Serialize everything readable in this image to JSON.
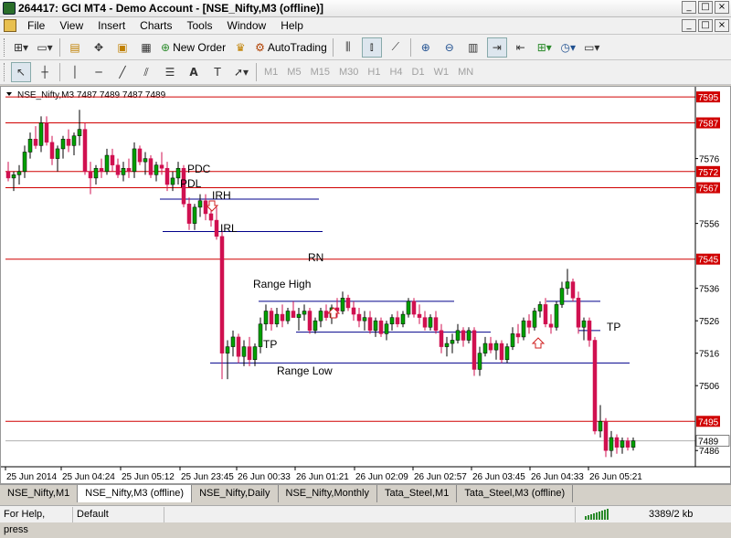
{
  "window": {
    "title": "264417: GCI MT4 - Demo Account - [NSE_Nifty,M3 (offline)]",
    "minimize": "_",
    "restore": "□",
    "close": "×"
  },
  "menu": [
    "File",
    "View",
    "Insert",
    "Charts",
    "Tools",
    "Window",
    "Help"
  ],
  "toolbar": {
    "new_order": "New Order",
    "autotrading": "AutoTrading"
  },
  "timeframes": [
    "M1",
    "M5",
    "M15",
    "M30",
    "H1",
    "H4",
    "D1",
    "W1",
    "MN"
  ],
  "chart": {
    "header": "NSE_Nifty,M3  7487 7489 7487 7489",
    "colors": {
      "bull": "#00a000",
      "bear": "#d01050",
      "red_line": "#d00000",
      "blue_line": "#00008b"
    }
  },
  "chart_data": {
    "type": "candlestick",
    "symbol": "NSE_Nifty",
    "timeframe": "M3",
    "y_ticks": [
      7576,
      7556,
      7536,
      7526,
      7516,
      7506,
      7486
    ],
    "ylim": [
      7481,
      7597
    ],
    "x_ticks": [
      "25 Jun 2014",
      "25 Jun 04:24",
      "25 Jun 05:12",
      "25 Jun 23:45",
      "26 Jun 00:33",
      "26 Jun 01:21",
      "26 Jun 02:09",
      "26 Jun 02:57",
      "26 Jun 03:45",
      "26 Jun 04:33",
      "26 Jun 05:21"
    ],
    "horizontal_lines": [
      {
        "price": 7595,
        "label": "7595",
        "color": "red"
      },
      {
        "price": 7587,
        "label": "7587",
        "color": "red"
      },
      {
        "price": 7572,
        "label": "7572",
        "color": "red"
      },
      {
        "price": 7567,
        "label": "7567",
        "color": "red"
      },
      {
        "price": 7545,
        "label": "7545",
        "color": "red"
      },
      {
        "price": 7495,
        "label": "7495",
        "color": "red"
      },
      {
        "price": 7489,
        "label": "7489",
        "color": "current"
      }
    ],
    "segments": [
      {
        "label": "IRH",
        "price": 7563.5,
        "x0": 174,
        "x1": 348
      },
      {
        "label": "IRL",
        "price": 7553.5,
        "x0": 177,
        "x1": 352
      },
      {
        "label": "",
        "price": 7532,
        "x0": 282,
        "x1": 496
      },
      {
        "label": "",
        "price": 7522.5,
        "x0": 323,
        "x1": 536
      },
      {
        "label": "",
        "price": 7513,
        "x0": 229,
        "x1": 688
      },
      {
        "label": "",
        "price": 7532,
        "x0": 597,
        "x1": 656
      },
      {
        "label": "",
        "price": 7523,
        "x0": 632,
        "x1": 656
      }
    ],
    "annotations": [
      "PDC",
      "PDL",
      "IRH",
      "IRL",
      "RN",
      "Range High",
      "TP",
      "TP",
      "Range Low"
    ],
    "candles": [
      [
        7572,
        7575,
        7569,
        7570
      ],
      [
        7570,
        7572,
        7566,
        7571
      ],
      [
        7571,
        7574,
        7568,
        7572
      ],
      [
        7572,
        7580,
        7570,
        7578
      ],
      [
        7578,
        7584,
        7576,
        7582
      ],
      [
        7582,
        7586,
        7579,
        7580
      ],
      [
        7580,
        7589,
        7578,
        7587
      ],
      [
        7587,
        7589,
        7580,
        7581
      ],
      [
        7581,
        7583,
        7574,
        7576
      ],
      [
        7576,
        7580,
        7572,
        7579
      ],
      [
        7579,
        7583,
        7576,
        7582
      ],
      [
        7582,
        7585,
        7578,
        7580
      ],
      [
        7580,
        7584,
        7577,
        7583
      ],
      [
        7583,
        7591,
        7580,
        7585
      ],
      [
        7585,
        7587,
        7571,
        7572
      ],
      [
        7572,
        7575,
        7565,
        7570
      ],
      [
        7570,
        7574,
        7568,
        7573
      ],
      [
        7573,
        7576,
        7570,
        7572
      ],
      [
        7572,
        7579,
        7571,
        7577
      ],
      [
        7577,
        7579,
        7572,
        7574
      ],
      [
        7574,
        7576,
        7570,
        7571
      ],
      [
        7571,
        7575,
        7569,
        7573
      ],
      [
        7573,
        7576,
        7570,
        7572
      ],
      [
        7572,
        7581,
        7570,
        7579
      ],
      [
        7579,
        7580,
        7574,
        7575
      ],
      [
        7575,
        7578,
        7571,
        7576
      ],
      [
        7576,
        7577,
        7570,
        7571
      ],
      [
        7571,
        7575,
        7569,
        7574
      ],
      [
        7574,
        7578,
        7571,
        7573
      ],
      [
        7573,
        7575,
        7566,
        7568
      ],
      [
        7568,
        7572,
        7566,
        7570
      ],
      [
        7570,
        7575,
        7568,
        7573
      ],
      [
        7573,
        7574,
        7561,
        7562
      ],
      [
        7562,
        7564,
        7554,
        7556
      ],
      [
        7556,
        7562,
        7554,
        7561
      ],
      [
        7561,
        7565,
        7558,
        7563
      ],
      [
        7563,
        7565,
        7557,
        7559
      ],
      [
        7559,
        7562,
        7555,
        7557
      ],
      [
        7557,
        7561,
        7551,
        7552
      ],
      [
        7552,
        7554,
        7508,
        7516
      ],
      [
        7516,
        7520,
        7508,
        7518
      ],
      [
        7518,
        7523,
        7515,
        7521
      ],
      [
        7521,
        7522,
        7513,
        7515
      ],
      [
        7515,
        7520,
        7512,
        7518
      ],
      [
        7518,
        7521,
        7512,
        7514
      ],
      [
        7514,
        7519,
        7512,
        7518
      ],
      [
        7518,
        7527,
        7516,
        7525
      ],
      [
        7525,
        7531,
        7523,
        7529
      ],
      [
        7529,
        7530,
        7523,
        7525
      ],
      [
        7525,
        7530,
        7524,
        7528
      ],
      [
        7528,
        7531,
        7524,
        7526
      ],
      [
        7526,
        7530,
        7525,
        7529
      ],
      [
        7529,
        7532,
        7527,
        7527
      ],
      [
        7527,
        7530,
        7523,
        7528
      ],
      [
        7528,
        7531,
        7526,
        7529
      ],
      [
        7529,
        7530,
        7522,
        7523
      ],
      [
        7523,
        7527,
        7522,
        7526
      ],
      [
        7526,
        7530,
        7524,
        7529
      ],
      [
        7529,
        7531,
        7526,
        7527
      ],
      [
        7527,
        7531,
        7525,
        7530
      ],
      [
        7530,
        7533,
        7527,
        7529
      ],
      [
        7529,
        7535,
        7528,
        7533
      ],
      [
        7533,
        7534,
        7529,
        7530
      ],
      [
        7530,
        7532,
        7526,
        7528
      ],
      [
        7528,
        7530,
        7524,
        7526
      ],
      [
        7526,
        7529,
        7523,
        7527
      ],
      [
        7527,
        7529,
        7522,
        7523
      ],
      [
        7523,
        7527,
        7521,
        7526
      ],
      [
        7526,
        7527,
        7521,
        7522
      ],
      [
        7522,
        7526,
        7520,
        7525
      ],
      [
        7525,
        7528,
        7523,
        7527
      ],
      [
        7527,
        7529,
        7524,
        7525
      ],
      [
        7525,
        7529,
        7524,
        7528
      ],
      [
        7528,
        7533,
        7527,
        7532
      ],
      [
        7532,
        7533,
        7527,
        7528
      ],
      [
        7528,
        7531,
        7525,
        7527
      ],
      [
        7527,
        7529,
        7523,
        7524
      ],
      [
        7524,
        7528,
        7523,
        7527
      ],
      [
        7527,
        7529,
        7522,
        7523
      ],
      [
        7523,
        7525,
        7516,
        7518
      ],
      [
        7518,
        7521,
        7515,
        7519
      ],
      [
        7519,
        7522,
        7516,
        7520
      ],
      [
        7520,
        7525,
        7519,
        7523
      ],
      [
        7523,
        7524,
        7518,
        7520
      ],
      [
        7520,
        7524,
        7519,
        7523
      ],
      [
        7523,
        7524,
        7509,
        7511
      ],
      [
        7511,
        7518,
        7509,
        7516
      ],
      [
        7516,
        7521,
        7515,
        7519
      ],
      [
        7519,
        7521,
        7516,
        7517
      ],
      [
        7517,
        7520,
        7514,
        7519
      ],
      [
        7519,
        7520,
        7513,
        7514
      ],
      [
        7514,
        7519,
        7513,
        7518
      ],
      [
        7518,
        7524,
        7517,
        7522
      ],
      [
        7522,
        7525,
        7519,
        7521
      ],
      [
        7521,
        7527,
        7520,
        7526
      ],
      [
        7526,
        7528,
        7522,
        7524
      ],
      [
        7524,
        7530,
        7523,
        7529
      ],
      [
        7529,
        7532,
        7527,
        7531
      ],
      [
        7531,
        7533,
        7524,
        7525
      ],
      [
        7525,
        7528,
        7522,
        7524
      ],
      [
        7524,
        7532,
        7523,
        7531
      ],
      [
        7531,
        7538,
        7530,
        7536
      ],
      [
        7536,
        7542,
        7534,
        7538
      ],
      [
        7538,
        7539,
        7532,
        7533
      ],
      [
        7533,
        7535,
        7522,
        7524
      ],
      [
        7524,
        7527,
        7520,
        7526
      ],
      [
        7526,
        7527,
        7518,
        7520
      ],
      [
        7520,
        7521,
        7491,
        7492
      ],
      [
        7492,
        7500,
        7490,
        7495
      ],
      [
        7495,
        7496,
        7484,
        7486
      ],
      [
        7486,
        7492,
        7484,
        7490
      ],
      [
        7490,
        7491,
        7485,
        7487
      ],
      [
        7487,
        7490,
        7485,
        7489
      ],
      [
        7489,
        7490,
        7486,
        7487
      ],
      [
        7487,
        7490,
        7486,
        7489
      ]
    ]
  },
  "tabs": [
    "NSE_Nifty,M1",
    "NSE_Nifty,M3 (offline)",
    "NSE_Nifty,Daily",
    "NSE_Nifty,Monthly",
    "Tata_Steel,M1",
    "Tata_Steel,M3 (offline)"
  ],
  "status": {
    "help": "For Help, press",
    "profile": "Default",
    "traffic": "3389/2 kb"
  }
}
